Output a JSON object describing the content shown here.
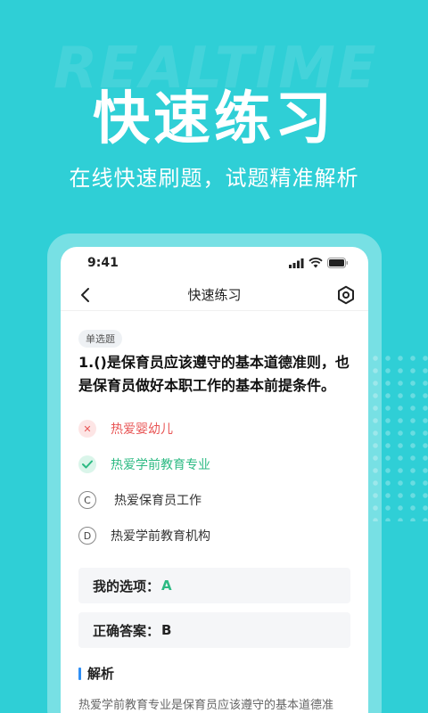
{
  "background": {
    "watermark": "REALTIME",
    "hero_title": "快速练习",
    "hero_subtitle": "在线快速刷题，试题精准解析",
    "colors": {
      "bg": "#2fcfd6",
      "accent_green": "#2cba83",
      "accent_red": "#e85555",
      "accent_blue": "#2f8ff5"
    }
  },
  "status_bar": {
    "time": "9:41",
    "icons": [
      "signal-icon",
      "wifi-icon",
      "battery-icon"
    ]
  },
  "nav": {
    "title": "快速练习",
    "back_icon": "chevron-left-icon",
    "settings_icon": "hexagon-gear-icon"
  },
  "question": {
    "type": "单选题",
    "text": "1.()是保育员应该遵守的基本道德准则，也是保育员做好本职工作的基本前提条件。",
    "options": [
      {
        "badge": "✕",
        "label": "热爱婴幼儿",
        "state": "wrong"
      },
      {
        "badge": "✓",
        "label": "热爱学前教育专业",
        "state": "correct"
      },
      {
        "badge": "C",
        "label": "热爱保育员工作",
        "state": "normal"
      },
      {
        "badge": "D",
        "label": "热爱学前教育机构",
        "state": "normal"
      }
    ]
  },
  "answers": {
    "mine_label": "我的选项：",
    "mine_value": "A",
    "correct_label": "正确答案：",
    "correct_value": "B"
  },
  "analysis": {
    "title": "解析",
    "text": "热爱学前教育专业是保育员应该遵守的基本道德准"
  }
}
